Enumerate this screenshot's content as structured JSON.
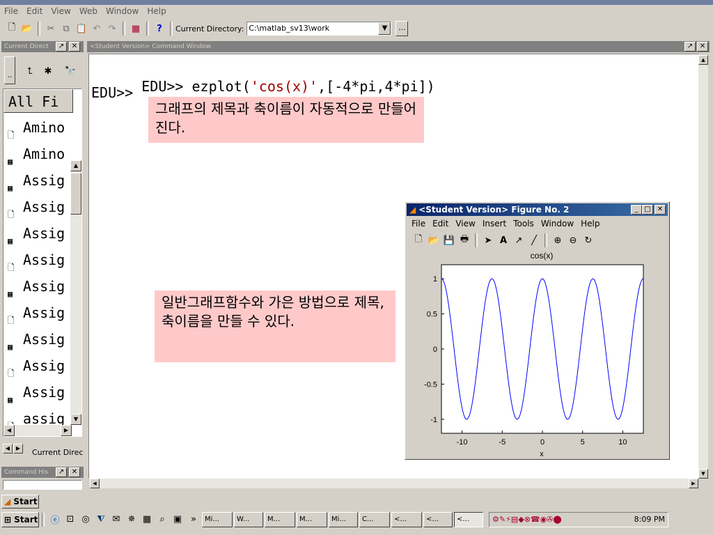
{
  "app": {
    "title": ""
  },
  "menu": [
    "File",
    "Edit",
    "View",
    "Web",
    "Window",
    "Help"
  ],
  "toolbar": {
    "current_dir_label": "Current Directory:",
    "current_dir_value": "C:\\matlab_sv13\\work",
    "browse_label": "..."
  },
  "left_panel": {
    "title": "Current Direct",
    "files_header": "All Fi",
    "files": [
      "Amino",
      "Amino",
      "Assig",
      "Assig",
      "Assig",
      "Assig",
      "Assig",
      "Assig",
      "Assig",
      "Assig",
      "Assig",
      "assig"
    ],
    "bottom_tab": "Current Direc",
    "history_title": "Command His"
  },
  "command_window": {
    "title": "<Student Version> Command Window",
    "prompt1": "EDU>>",
    "cmd_func": "ezplot(",
    "cmd_str": "'cos(x)'",
    "cmd_rest": ",[-4*pi,4*pi])",
    "prompt2": "EDU>>"
  },
  "notes": {
    "note1": "그래프의 제목과 축이름이 자동적으로 만들어진다.",
    "note2": "일반그래프함수와 가은 방법으로 제목, 축이름을 만들 수 있다."
  },
  "figure": {
    "title": "<Student Version> Figure No. 2",
    "menu": [
      "File",
      "Edit",
      "View",
      "Insert",
      "Tools",
      "Window",
      "Help"
    ]
  },
  "chart_data": {
    "type": "line",
    "title": "cos(x)",
    "xlabel": "x",
    "ylabel": "",
    "xlim": [
      -12.566,
      12.566
    ],
    "ylim": [
      -1.2,
      1.2
    ],
    "xticks": [
      -10,
      -5,
      0,
      5,
      10
    ],
    "yticks": [
      1,
      0.5,
      0,
      -0.5,
      -1
    ],
    "function": "cos(x)",
    "line_color": "#0000ff",
    "grid": false
  },
  "taskbar": {
    "start_label": "Start",
    "start_label2": "Start",
    "tasks": [
      "Mi...",
      "W...",
      "M...",
      "M...",
      "Mi...",
      "C...",
      "<...",
      "<...",
      "<..."
    ],
    "clock": "8:09 PM"
  }
}
